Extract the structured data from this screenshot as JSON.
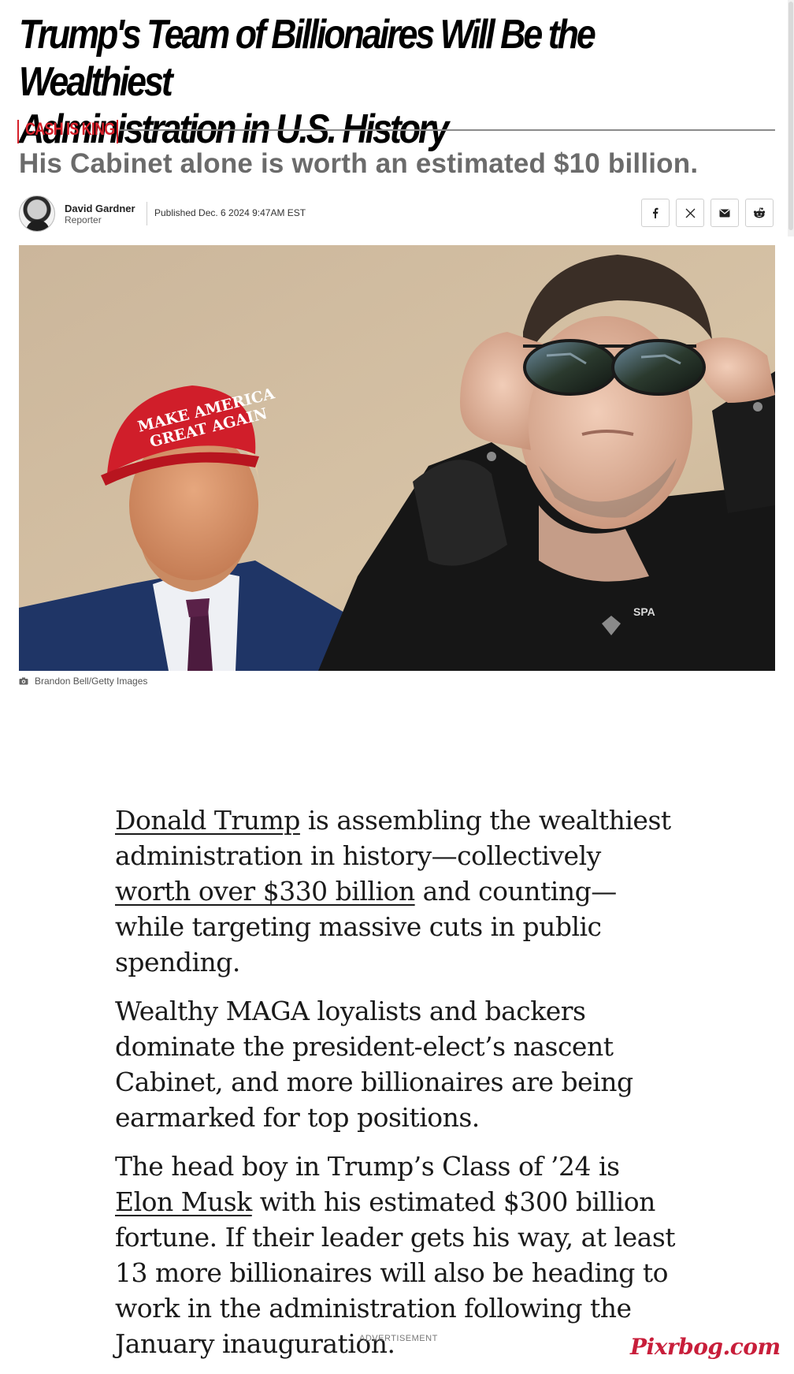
{
  "article": {
    "headline_line1": "Trump's Team of Billionaires Will Be the Wealthiest",
    "headline_line2": "Administration in U.S. History",
    "kicker": "CASH IS KING",
    "dek": "His Cabinet alone is worth an estimated $10 billion.",
    "author": {
      "name": "David Gardner",
      "role": "Reporter"
    },
    "published": "Published Dec. 6 2024 9:47AM EST",
    "share_icons": [
      "facebook-icon",
      "x-icon",
      "email-icon",
      "reddit-icon"
    ],
    "hero_image": {
      "cap_text_line1": "MAKE AMERICA",
      "cap_text_line2": "GREAT AGAIN",
      "shirt_logo": "SPA",
      "credit": "Brandon Bell/Getty Images"
    },
    "body": {
      "p1_link1": "Donald Trump",
      "p1_text1": " is assembling the wealthiest administration in history—collectively ",
      "p1_link2": "worth over $330 billion",
      "p1_text2": " and counting—while targeting massive cuts in public spending.",
      "p2": "Wealthy MAGA loyalists and backers dominate the president-elect’s nascent Cabinet, and more billionaires are being earmarked for top positions.",
      "p3_text1": "The head boy in Trump’s Class of ’24 is ",
      "p3_link1": "Elon Musk",
      "p3_text2": " with his estimated $300 billion fortune. If their leader gets his way, at least 13 more billionaires will also be heading to work in the administration following the January inauguration."
    },
    "ad_label": "ADVERTISEMENT",
    "watermark": "Pixrbog.com"
  },
  "colors": {
    "accent_red": "#d6202a",
    "dek_gray": "#6b6b6b",
    "watermark_red": "#c81e3a"
  }
}
